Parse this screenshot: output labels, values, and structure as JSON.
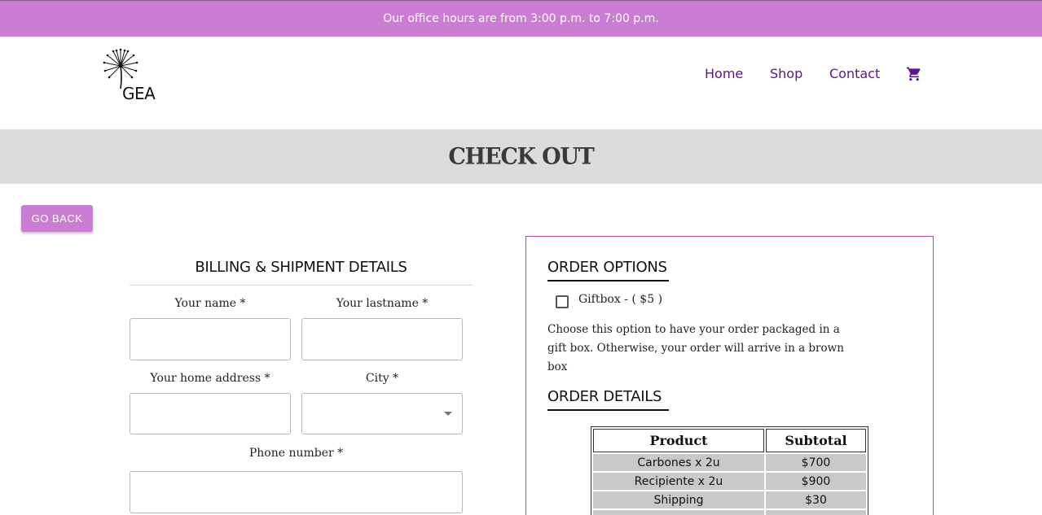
{
  "announcement": "Our office hours are from 3:00 p.m. to 7:00 p.m.",
  "brand": {
    "logo_text": "GEA"
  },
  "nav": {
    "home": "Home",
    "shop": "Shop",
    "contact": "Contact",
    "cart_icon": "shopping-cart-icon"
  },
  "page_title": "CHECK OUT",
  "go_back_label": "GO BACK",
  "billing": {
    "title": "BILLING & SHIPMENT DETAILS",
    "name_label": "Your name *",
    "lastname_label": "Your lastname *",
    "address_label": "Your home address *",
    "city_label": "City *",
    "phone_label": "Phone number *",
    "name_value": "",
    "lastname_value": "",
    "address_value": "",
    "city_value": "",
    "phone_value": ""
  },
  "order_options": {
    "title": "ORDER OPTIONS",
    "giftbox_label": "Giftbox - ( $5 )",
    "giftbox_checked": false,
    "description": "Choose this option to have your order packaged in a gift box. Otherwise, your order will arrive in a brown box"
  },
  "order_details": {
    "title": "ORDER DETAILS",
    "columns": [
      "Product",
      "Subtotal"
    ],
    "rows": [
      {
        "product": "Carbones x 2u",
        "subtotal": "$700"
      },
      {
        "product": "Recipiente x 2u",
        "subtotal": "$900"
      },
      {
        "product": "Shipping",
        "subtotal": "$30"
      }
    ]
  },
  "colors": {
    "accent": "#cb7dd3",
    "nav_link": "#5a1494",
    "box_border": "#b04bb8",
    "band": "#dcdcdc"
  }
}
